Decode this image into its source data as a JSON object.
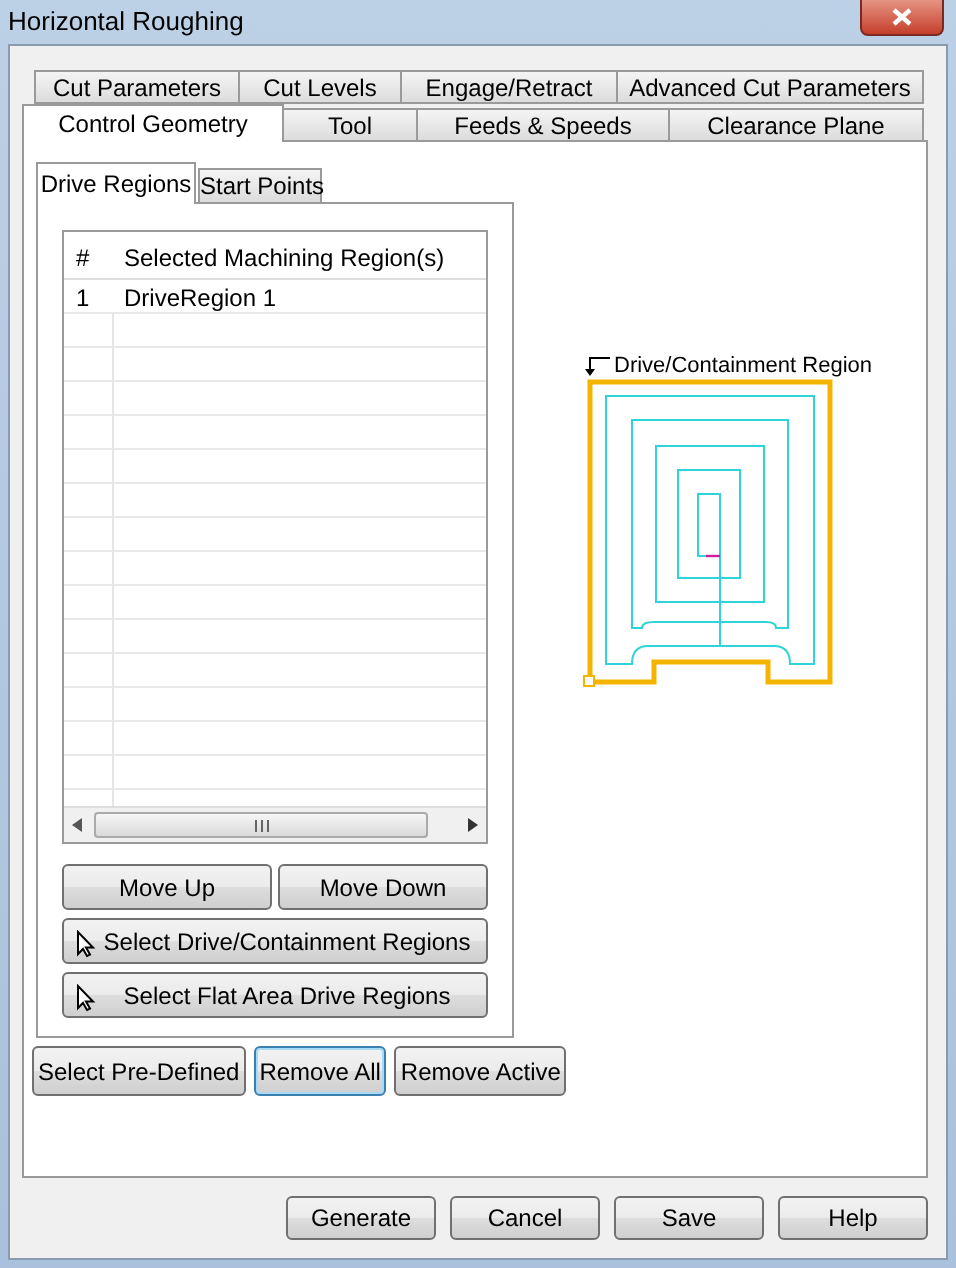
{
  "window": {
    "title": "Horizontal Roughing"
  },
  "tab_rows": [
    [
      {
        "label": "Cut Parameters",
        "selected": false
      },
      {
        "label": "Cut Levels",
        "selected": false
      },
      {
        "label": "Engage/Retract",
        "selected": false
      },
      {
        "label": "Advanced Cut Parameters",
        "selected": false
      }
    ],
    [
      {
        "label": "Control Geometry",
        "selected": true
      },
      {
        "label": "Tool",
        "selected": false
      },
      {
        "label": "Feeds & Speeds",
        "selected": false
      },
      {
        "label": "Clearance Plane",
        "selected": false
      }
    ]
  ],
  "sub_tabs": [
    {
      "label": "Drive Regions",
      "selected": true
    },
    {
      "label": "Start Points",
      "selected": false
    }
  ],
  "region_table": {
    "columns": [
      "#",
      "Selected Machining Region(s)"
    ],
    "rows": [
      [
        "1",
        "DriveRegion 1"
      ]
    ]
  },
  "list_buttons": [
    {
      "label": "Move Up",
      "kind": "plain"
    },
    {
      "label": "Move Down",
      "kind": "plain"
    },
    {
      "label": "Select Drive/Containment Regions",
      "kind": "pick"
    },
    {
      "label": "Select Flat Area Drive Regions",
      "kind": "pick"
    }
  ],
  "region_buttons": [
    {
      "label": "Select Pre-Defined",
      "focused": false
    },
    {
      "label": "Remove All",
      "focused": true
    },
    {
      "label": "Remove Active",
      "focused": false
    }
  ],
  "preview": {
    "label": "Drive/Containment Region"
  },
  "footer_buttons": [
    "Generate",
    "Cancel",
    "Save",
    "Help"
  ]
}
